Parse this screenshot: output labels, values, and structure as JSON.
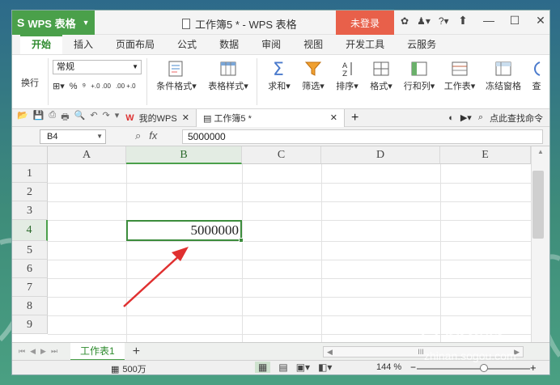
{
  "titlebar": {
    "app_name": "WPS 表格",
    "app_logo": "S",
    "doc_title": "工作簿5 * - WPS 表格",
    "login_label": "未登录"
  },
  "menu_tabs": [
    "开始",
    "插入",
    "页面布局",
    "公式",
    "数据",
    "审阅",
    "视图",
    "开发工具",
    "云服务"
  ],
  "ribbon": {
    "wrap_label": "换行",
    "number_format": "常规",
    "percent": "%",
    "comma": "⁹",
    "dec_inc": "+.0 .00",
    "dec_dec": ".00 +.0",
    "items": [
      {
        "label": "条件格式"
      },
      {
        "label": "表格样式"
      },
      {
        "label": "求和"
      },
      {
        "label": "筛选"
      },
      {
        "label": "排序"
      },
      {
        "label": "格式"
      },
      {
        "label": "行和列"
      },
      {
        "label": "工作表"
      },
      {
        "label": "冻结窗格"
      },
      {
        "label": "查"
      }
    ]
  },
  "doc_tabs": {
    "home_label": "我的WPS",
    "active_label": "工作簿5 *",
    "search_label": "点此查找命令"
  },
  "formula_bar": {
    "cell_ref": "B4",
    "fx": "fx",
    "value": "5000000"
  },
  "grid": {
    "columns": [
      "A",
      "B",
      "C",
      "D",
      "E"
    ],
    "rows": [
      "1",
      "2",
      "3",
      "4",
      "5",
      "6",
      "7",
      "8",
      "9"
    ],
    "active_cell_value": "5000000"
  },
  "sheetbar": {
    "sheet_name": "工作表1",
    "add_label": "+",
    "hscroll_thumb": "III"
  },
  "statusbar": {
    "sum_value": "500万",
    "zoom": "144 %"
  },
  "watermark": {
    "brand": "搜狗指南",
    "url": "zhinan.sogou.com"
  },
  "colors": {
    "accent": "#4aa04a",
    "login": "#e8604a",
    "arrow": "#e03030"
  }
}
